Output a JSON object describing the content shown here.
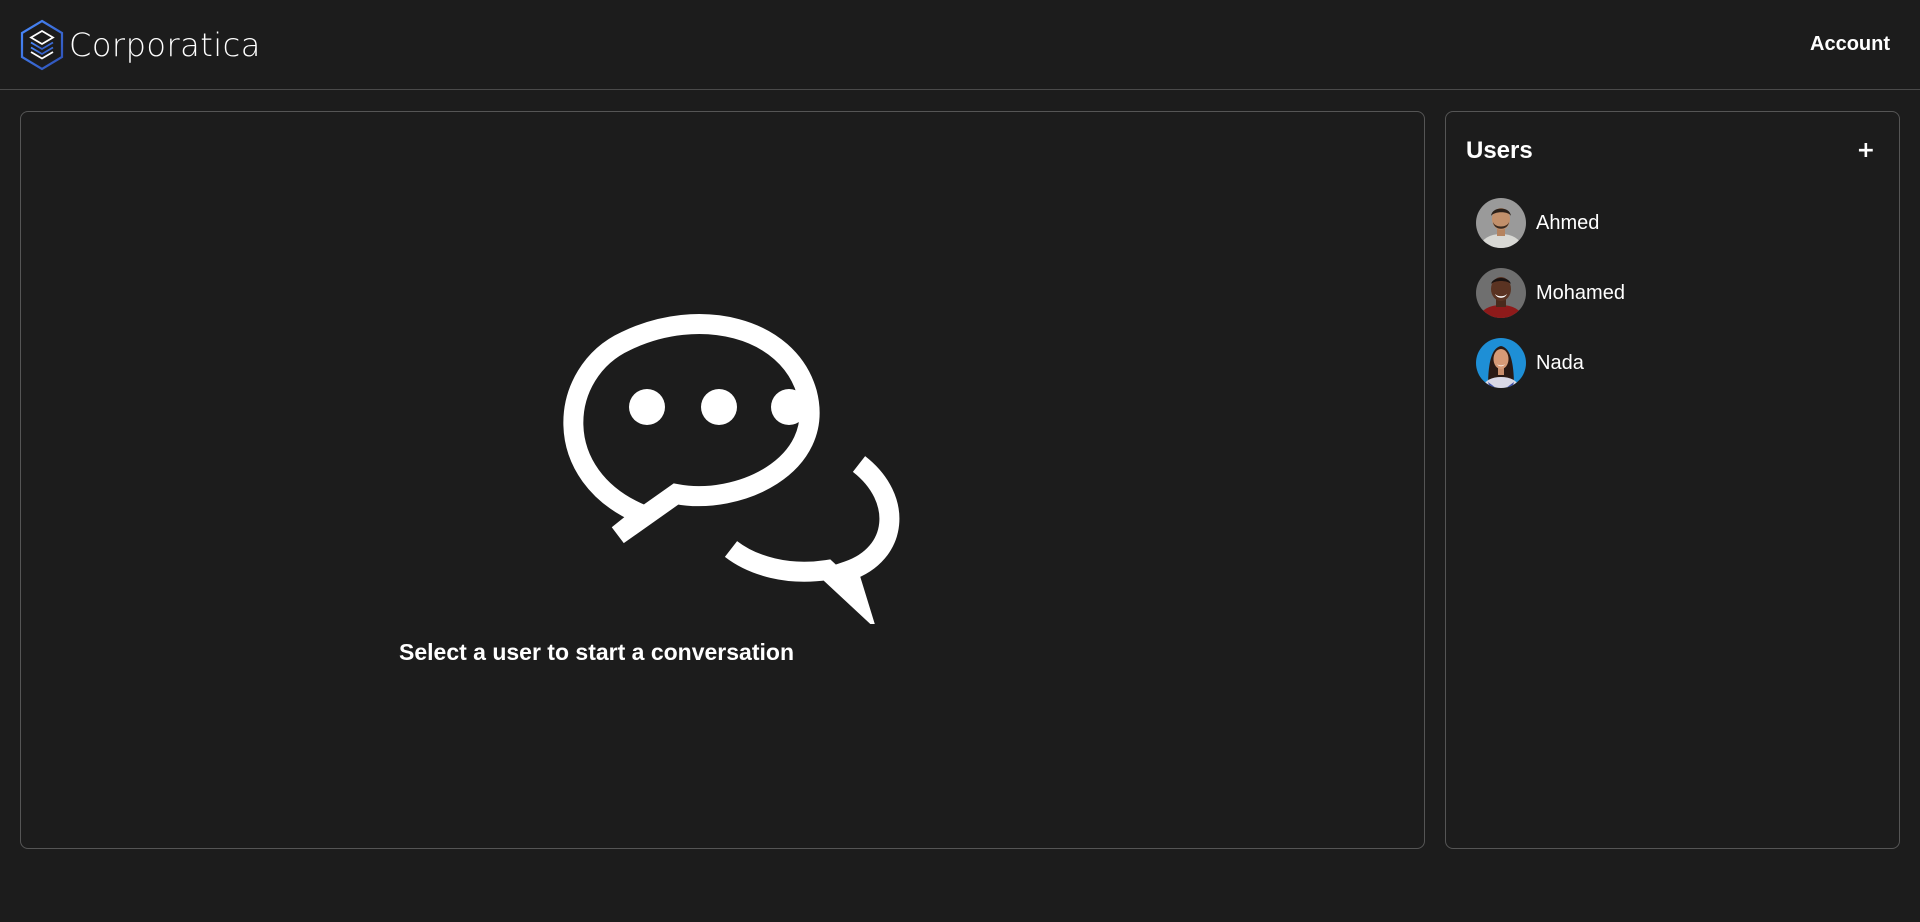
{
  "header": {
    "brand_name": "Corporatica",
    "account_label": "Account"
  },
  "chat": {
    "empty_message": "Select a user to start a conversation",
    "icon": "chat-bubbles-icon"
  },
  "users": {
    "title": "Users",
    "add_label": "+",
    "items": [
      {
        "name": "Ahmed",
        "avatar": "avatar-photo"
      },
      {
        "name": "Mohamed",
        "avatar": "avatar-photo"
      },
      {
        "name": "Nada",
        "avatar": "avatar-photo"
      }
    ]
  },
  "colors": {
    "background": "#1c1c1c",
    "border": "#555555",
    "text": "#ffffff",
    "logo_accent": "#3b6fd6"
  }
}
